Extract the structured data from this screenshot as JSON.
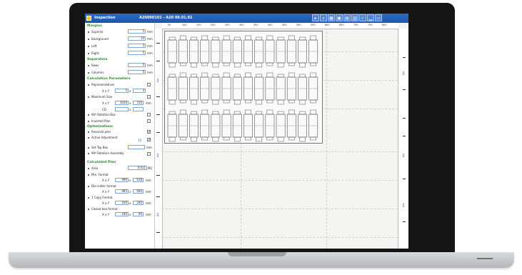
{
  "window": {
    "title": "Inspection",
    "job_id": "A20090101 - A20 00.01.01"
  },
  "toolbar": {
    "buttons": [
      "cursor-icon",
      "zoom-icon",
      "grid-icon",
      "layout-icon",
      "print-icon",
      "export-icon",
      "check-icon",
      "minimize-icon",
      "window-icon"
    ]
  },
  "sidebar": {
    "margins": {
      "title": "Margins",
      "rows": [
        {
          "label": "Superior",
          "value": "5",
          "unit": "mm"
        },
        {
          "label": "Background",
          "value": "15",
          "unit": "mm"
        },
        {
          "label": "Left",
          "value": "5",
          "unit": "mm"
        },
        {
          "label": "Right",
          "value": "5",
          "unit": "mm"
        }
      ]
    },
    "separators": {
      "title": "Separators",
      "rows": [
        {
          "label": "Rows",
          "value": "0",
          "unit": "mm"
        },
        {
          "label": "Columns",
          "value": "0",
          "unit": "mm"
        }
      ]
    },
    "calc_params": {
      "title": "Calculation Parameters",
      "representatives": "Representatives",
      "xy_label": "X x Y",
      "rep_x": "5",
      "rep_y": "3",
      "maximum_size": "Maximum Size",
      "max_x": "1020",
      "max_y": "720",
      "max_unit": "mm",
      "cd_label": "CD",
      "rotation_box": "90º Rotation Box",
      "inverted_plan": "Inverted Plan"
    },
    "optimizations": {
      "title": "Optimizations",
      "reversal_plan": "Reversal plan",
      "active_adjustment": "Active Adjustment",
      "active_value": "10",
      "set_top_box": "Set Top Box",
      "set_top_unit": "mm",
      "rotation_assembly": "90º Rotation Assembly"
    },
    "calculated": {
      "title": "Calculated Plan",
      "area_label": "Area",
      "area_value": "0.611",
      "area_unit": "M2",
      "min_format": "Min. Format",
      "min_x": "990",
      "min_y": "618",
      "die_cutter": "Die-cutter format",
      "die_x": "985",
      "die_y": "600",
      "copy_format": "1 Copy Format",
      "copy_x": "160",
      "copy_y": "240",
      "closed_box": "Closed box format",
      "closed_x": "240",
      "closed_y": "90",
      "xy_label": "X x Y",
      "unit": "mm"
    }
  },
  "canvas": {
    "ruler_top": [
      "50",
      "100",
      "150",
      "200",
      "250",
      "300",
      "350",
      "400",
      "450",
      "500",
      "550",
      "600",
      "650",
      "700",
      "750",
      "800"
    ],
    "nesting": {
      "rows": 3,
      "cols": 14,
      "bg_color": "#f4f4f2",
      "shape_color": "#555555"
    }
  }
}
